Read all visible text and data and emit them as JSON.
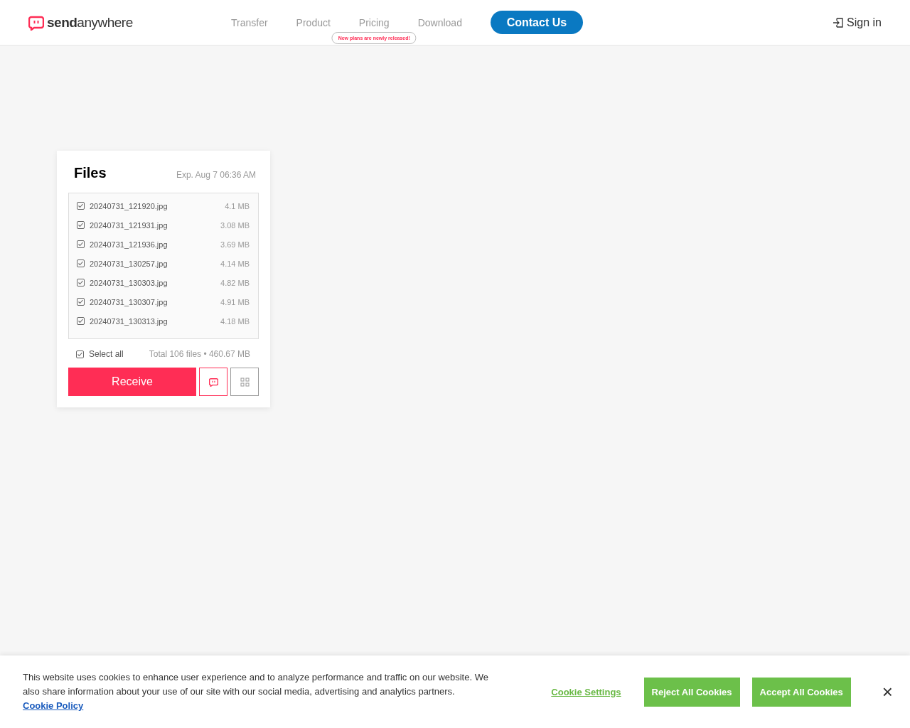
{
  "header": {
    "logo": "**send**anywhere",
    "nav": [
      {
        "label": "Transfer",
        "selected": false
      },
      {
        "label": "Product",
        "selected": false
      },
      {
        "label": "Pricing",
        "selected": false
      },
      {
        "label": "Download",
        "selected": false
      }
    ],
    "pricing_tooltip": "New plans are newly released!",
    "contact_button": "Contact Us",
    "sign_in": "Sign in"
  },
  "files_card": {
    "title": "Files",
    "expiry": "Exp. Aug 7 06:36 AM",
    "files": [
      {
        "name": "20240731_121920.jpg",
        "size": "4.1 MB",
        "checked": true
      },
      {
        "name": "20240731_121931.jpg",
        "size": "3.08 MB",
        "checked": true
      },
      {
        "name": "20240731_121936.jpg",
        "size": "3.69 MB",
        "checked": true
      },
      {
        "name": "20240731_130257.jpg",
        "size": "4.14 MB",
        "checked": true
      },
      {
        "name": "20240731_130303.jpg",
        "size": "4.82 MB",
        "checked": true
      },
      {
        "name": "20240731_130307.jpg",
        "size": "4.91 MB",
        "checked": true
      },
      {
        "name": "20240731_130313.jpg",
        "size": "4.18 MB",
        "checked": true
      }
    ],
    "select_all": {
      "label": "Select all",
      "checked": true
    },
    "total": "Total 106 files • 460.67 MB",
    "receive_button": "Receive"
  },
  "cookie_banner": {
    "text": "This website uses cookies to enhance user experience and to analyze performance and traffic on our website. We also share information about your use of our site with our social media, advertising and analytics partners.",
    "policy_link": "Cookie Policy",
    "settings_link": "Cookie Settings",
    "reject_button": "Reject All Cookies",
    "accept_button": "Accept All Cookies",
    "close": "×"
  }
}
